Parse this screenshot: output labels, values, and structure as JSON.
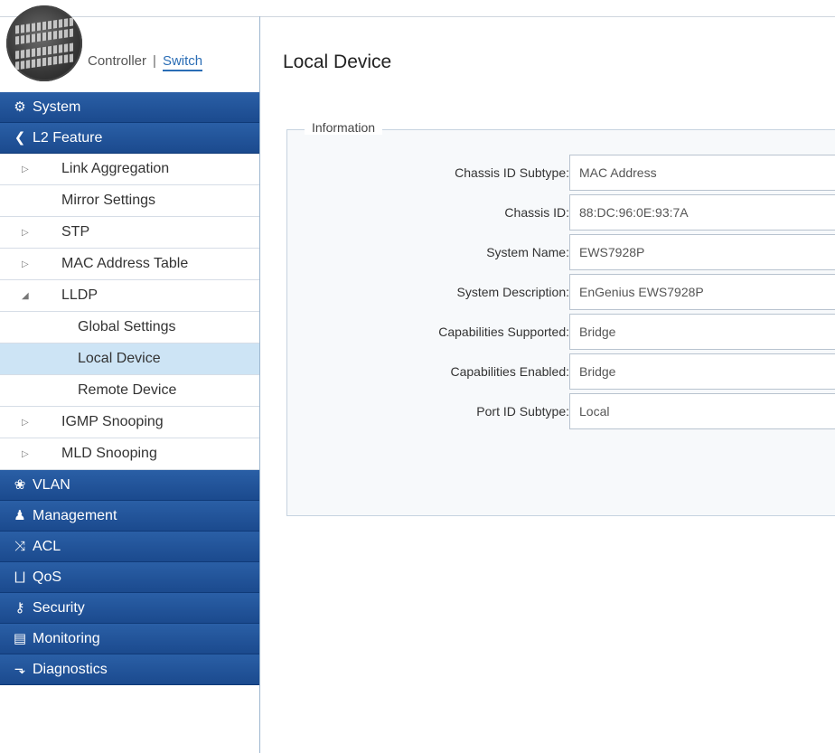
{
  "header": {
    "controller_label": "Controller",
    "separator": "|",
    "switch_label": "Switch"
  },
  "sidebar": {
    "items": [
      {
        "type": "cat",
        "label": "System",
        "icon": "gear-icon"
      },
      {
        "type": "cat",
        "label": "L2 Feature",
        "icon": "share-icon"
      },
      {
        "type": "sub",
        "label": "Link Aggregation",
        "arrow": "collapsed"
      },
      {
        "type": "sub",
        "label": "Mirror Settings",
        "arrow": "none"
      },
      {
        "type": "sub",
        "label": "STP",
        "arrow": "collapsed"
      },
      {
        "type": "sub",
        "label": "MAC Address Table",
        "arrow": "collapsed"
      },
      {
        "type": "sub",
        "label": "LLDP",
        "arrow": "expanded"
      },
      {
        "type": "subsub",
        "label": "Global Settings"
      },
      {
        "type": "subsub",
        "label": "Local Device",
        "active": true
      },
      {
        "type": "subsub",
        "label": "Remote Device"
      },
      {
        "type": "sub",
        "label": "IGMP Snooping",
        "arrow": "collapsed"
      },
      {
        "type": "sub",
        "label": "MLD Snooping",
        "arrow": "collapsed"
      },
      {
        "type": "cat",
        "label": "VLAN",
        "icon": "network-icon"
      },
      {
        "type": "cat",
        "label": "Management",
        "icon": "user-icon"
      },
      {
        "type": "cat",
        "label": "ACL",
        "icon": "shuffle-icon"
      },
      {
        "type": "cat",
        "label": "QoS",
        "icon": "qos-icon"
      },
      {
        "type": "cat",
        "label": "Security",
        "icon": "key-icon"
      },
      {
        "type": "cat",
        "label": "Monitoring",
        "icon": "monitor-icon"
      },
      {
        "type": "cat",
        "label": "Diagnostics",
        "icon": "stethoscope-icon"
      }
    ]
  },
  "main": {
    "title": "Local Device",
    "section_legend": "Information",
    "fields": [
      {
        "label": "Chassis ID Subtype:",
        "value": "MAC Address"
      },
      {
        "label": "Chassis ID:",
        "value": "88:DC:96:0E:93:7A"
      },
      {
        "label": "System Name:",
        "value": "EWS7928P"
      },
      {
        "label": "System Description:",
        "value": "EnGenius EWS7928P"
      },
      {
        "label": "Capabilities Supported:",
        "value": "Bridge"
      },
      {
        "label": "Capabilities Enabled:",
        "value": "Bridge"
      },
      {
        "label": "Port ID Subtype:",
        "value": "Local"
      }
    ]
  },
  "colors": {
    "sidebar_category_bg": "#1b4a8e",
    "sidebar_active_bg": "#cde4f5",
    "link_blue": "#2a6db5"
  }
}
